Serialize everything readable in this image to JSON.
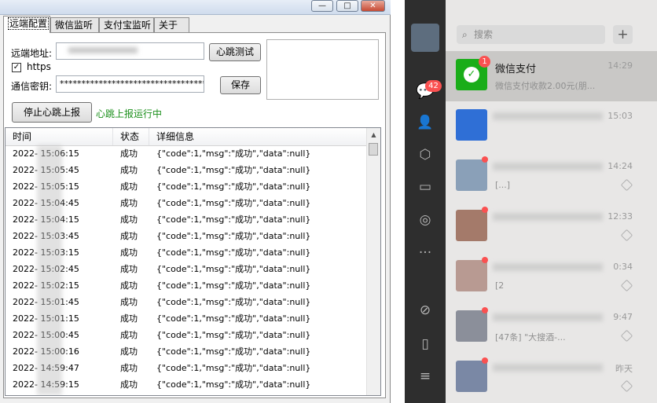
{
  "window": {
    "tabs": [
      {
        "label": "远端配置"
      },
      {
        "label": "微信监听"
      },
      {
        "label": "支付宝监听"
      },
      {
        "label": "关于"
      }
    ],
    "controls": {
      "minimize": "—",
      "maximize": "□",
      "close": "✕"
    }
  },
  "config": {
    "remote_label": "远端地址:",
    "remote_value": "",
    "heartbeat_test_button": "心跳测试",
    "https_label": "https",
    "https_checked": true,
    "secret_label": "通信密钥:",
    "secret_value": "************************************",
    "save_button": "保存",
    "stop_button": "停止心跳上报",
    "status_text": "心跳上报运行中",
    "status_color": "#1a8f1a"
  },
  "log": {
    "columns": [
      "时间",
      "状态",
      "详细信息"
    ],
    "rows": [
      {
        "time": "2022-  15:06:15",
        "status": "成功",
        "detail": "{\"code\":1,\"msg\":\"成功\",\"data\":null}"
      },
      {
        "time": "2022-  15:05:45",
        "status": "成功",
        "detail": "{\"code\":1,\"msg\":\"成功\",\"data\":null}"
      },
      {
        "time": "2022-  15:05:15",
        "status": "成功",
        "detail": "{\"code\":1,\"msg\":\"成功\",\"data\":null}"
      },
      {
        "time": "2022-  15:04:45",
        "status": "成功",
        "detail": "{\"code\":1,\"msg\":\"成功\",\"data\":null}"
      },
      {
        "time": "2022-  15:04:15",
        "status": "成功",
        "detail": "{\"code\":1,\"msg\":\"成功\",\"data\":null}"
      },
      {
        "time": "2022-  15:03:45",
        "status": "成功",
        "detail": "{\"code\":1,\"msg\":\"成功\",\"data\":null}"
      },
      {
        "time": "2022-  15:03:15",
        "status": "成功",
        "detail": "{\"code\":1,\"msg\":\"成功\",\"data\":null}"
      },
      {
        "time": "2022-  15:02:45",
        "status": "成功",
        "detail": "{\"code\":1,\"msg\":\"成功\",\"data\":null}"
      },
      {
        "time": "2022-  15:02:15",
        "status": "成功",
        "detail": "{\"code\":1,\"msg\":\"成功\",\"data\":null}"
      },
      {
        "time": "2022-  15:01:45",
        "status": "成功",
        "detail": "{\"code\":1,\"msg\":\"成功\",\"data\":null}"
      },
      {
        "time": "2022-  15:01:15",
        "status": "成功",
        "detail": "{\"code\":1,\"msg\":\"成功\",\"data\":null}"
      },
      {
        "time": "2022-  15:00:45",
        "status": "成功",
        "detail": "{\"code\":1,\"msg\":\"成功\",\"data\":null}"
      },
      {
        "time": "2022-  15:00:16",
        "status": "成功",
        "detail": "{\"code\":1,\"msg\":\"成功\",\"data\":null}"
      },
      {
        "time": "2022-  14:59:47",
        "status": "成功",
        "detail": "{\"code\":1,\"msg\":\"成功\",\"data\":null}"
      },
      {
        "time": "2022-  14:59:15",
        "status": "成功",
        "detail": "{\"code\":1,\"msg\":\"成功\",\"data\":null}"
      }
    ]
  },
  "wechat": {
    "unread_badge": "42",
    "search_placeholder": "搜索",
    "plus": "+",
    "nav_icons": [
      "chat-icon",
      "contacts-icon",
      "favorites-icon",
      "files-icon",
      "moments-icon",
      "more-icon",
      "miniprogram-icon",
      "phone-icon",
      "menu-icon"
    ],
    "chats": [
      {
        "name": "微信支付",
        "msg": "微信支付收款2.00元(朋...",
        "time": "14:29",
        "badge": "1",
        "avatar_color": "#1aad19"
      },
      {
        "name": "",
        "msg": "",
        "time": "15:03",
        "avatar_color": "#2f6fd6"
      },
      {
        "name": "",
        "msg": "[...]",
        "time": "14:24",
        "avatar_color": "#8aa0b8"
      },
      {
        "name": "",
        "msg": "",
        "time": "12:33",
        "avatar_color": "#a47a6a"
      },
      {
        "name": "",
        "msg": "[2",
        "time": "0:34",
        "avatar_color": "#b89a92"
      },
      {
        "name": "",
        "msg": "[47条] \"大搜酒-...",
        "time": "9:47",
        "avatar_color": "#8b8f9a"
      },
      {
        "name": "",
        "msg": "",
        "time": "昨天",
        "avatar_color": "#7a88a5"
      }
    ]
  }
}
